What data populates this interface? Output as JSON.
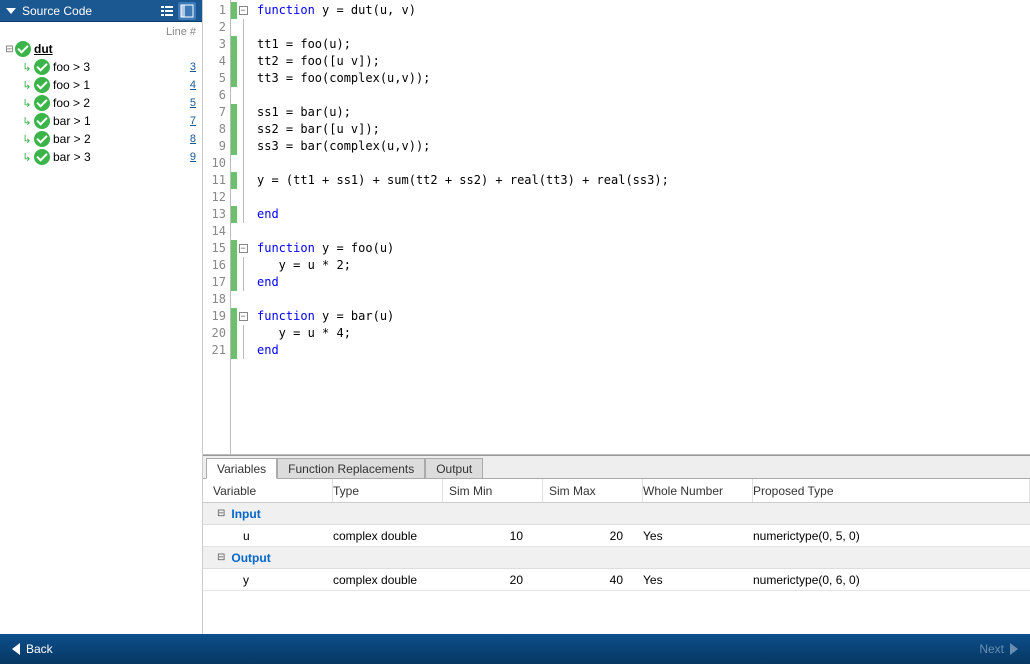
{
  "sidebar": {
    "title": "Source Code",
    "line_header": "Line #",
    "root": {
      "label": "dut"
    },
    "items": [
      {
        "label": "foo > 3",
        "line": "3"
      },
      {
        "label": "foo > 1",
        "line": "4"
      },
      {
        "label": "foo > 2",
        "line": "5"
      },
      {
        "label": "bar > 1",
        "line": "7"
      },
      {
        "label": "bar > 2",
        "line": "8"
      },
      {
        "label": "bar > 3",
        "line": "9"
      }
    ]
  },
  "code": {
    "lines": [
      {
        "n": "1",
        "cov": true,
        "fold": "minus",
        "kw": "function",
        "rest": " y = dut(u, v)"
      },
      {
        "n": "2",
        "cov": false,
        "fold": "line",
        "kw": "",
        "rest": ""
      },
      {
        "n": "3",
        "cov": true,
        "fold": "line",
        "kw": "",
        "rest": "tt1 = foo(u);"
      },
      {
        "n": "4",
        "cov": true,
        "fold": "line",
        "kw": "",
        "rest": "tt2 = foo([u v]);"
      },
      {
        "n": "5",
        "cov": true,
        "fold": "line",
        "kw": "",
        "rest": "tt3 = foo(complex(u,v));"
      },
      {
        "n": "6",
        "cov": false,
        "fold": "line",
        "kw": "",
        "rest": ""
      },
      {
        "n": "7",
        "cov": true,
        "fold": "line",
        "kw": "",
        "rest": "ss1 = bar(u);"
      },
      {
        "n": "8",
        "cov": true,
        "fold": "line",
        "kw": "",
        "rest": "ss2 = bar([u v]);"
      },
      {
        "n": "9",
        "cov": true,
        "fold": "line",
        "kw": "",
        "rest": "ss3 = bar(complex(u,v));"
      },
      {
        "n": "10",
        "cov": false,
        "fold": "line",
        "kw": "",
        "rest": ""
      },
      {
        "n": "11",
        "cov": true,
        "fold": "line",
        "kw": "",
        "rest": "y = (tt1 + ss1) + sum(tt2 + ss2) + real(tt3) + real(ss3);"
      },
      {
        "n": "12",
        "cov": false,
        "fold": "line",
        "kw": "",
        "rest": ""
      },
      {
        "n": "13",
        "cov": true,
        "fold": "end",
        "kw": "end",
        "rest": ""
      },
      {
        "n": "14",
        "cov": false,
        "fold": "",
        "kw": "",
        "rest": ""
      },
      {
        "n": "15",
        "cov": true,
        "fold": "minus",
        "kw": "function",
        "rest": " y = foo(u)"
      },
      {
        "n": "16",
        "cov": true,
        "fold": "line",
        "kw": "",
        "rest": "   y = u * 2;"
      },
      {
        "n": "17",
        "cov": true,
        "fold": "end",
        "kw": "end",
        "rest": ""
      },
      {
        "n": "18",
        "cov": false,
        "fold": "",
        "kw": "",
        "rest": ""
      },
      {
        "n": "19",
        "cov": true,
        "fold": "minus",
        "kw": "function",
        "rest": " y = bar(u)"
      },
      {
        "n": "20",
        "cov": true,
        "fold": "line",
        "kw": "",
        "rest": "   y = u * 4;"
      },
      {
        "n": "21",
        "cov": true,
        "fold": "end",
        "kw": "end",
        "rest": ""
      }
    ]
  },
  "tabs": {
    "t0": "Variables",
    "t1": "Function Replacements",
    "t2": "Output"
  },
  "table": {
    "headers": {
      "var": "Variable",
      "type": "Type",
      "min": "Sim Min",
      "max": "Sim Max",
      "whole": "Whole Number",
      "prop": "Proposed Type"
    },
    "groups": {
      "input": "Input",
      "output": "Output"
    },
    "rows": {
      "r0": {
        "var": "u",
        "type": "complex double",
        "min": "10",
        "max": "20",
        "whole": "Yes",
        "prop": "numerictype(0, 5, 0)"
      },
      "r1": {
        "var": "y",
        "type": "complex double",
        "min": "20",
        "max": "40",
        "whole": "Yes",
        "prop": "numerictype(0, 6, 0)"
      }
    }
  },
  "footer": {
    "back": "Back",
    "next": "Next"
  }
}
